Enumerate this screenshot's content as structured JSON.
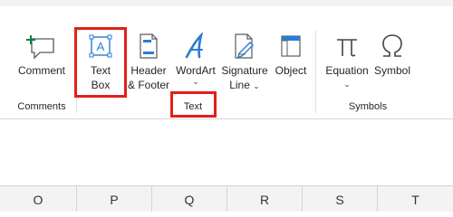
{
  "ribbon": {
    "groups": {
      "comments": {
        "label": "Comments"
      },
      "text": {
        "label": "Text"
      },
      "symbols": {
        "label": "Symbols"
      }
    },
    "buttons": {
      "comment": {
        "label": "Comment"
      },
      "text_box": {
        "line1": "Text",
        "line2": "Box"
      },
      "header_footer": {
        "line1": "Header",
        "line2": "& Footer"
      },
      "wordart": {
        "label": "WordArt",
        "chevron": "⌄"
      },
      "signature_line": {
        "line1": "Signature",
        "line2": "Line",
        "chevron": "⌄"
      },
      "object": {
        "label": "Object"
      },
      "equation": {
        "label": "Equation",
        "chevron": "⌄"
      },
      "symbol": {
        "label": "Symbol"
      }
    },
    "icons": {
      "comment": "comment-plus-icon",
      "text_box": "text-box-icon",
      "header_footer": "header-footer-icon",
      "wordart": "wordart-icon",
      "signature_line": "signature-line-icon",
      "object": "object-icon",
      "equation": "pi-icon",
      "symbol": "omega-icon"
    }
  },
  "sheet": {
    "columns": [
      "O",
      "P",
      "Q",
      "R",
      "S",
      "T"
    ]
  },
  "colors": {
    "highlight": "#e0201b",
    "accent_blue": "#2b7cd3",
    "accent_green": "#107c41"
  }
}
